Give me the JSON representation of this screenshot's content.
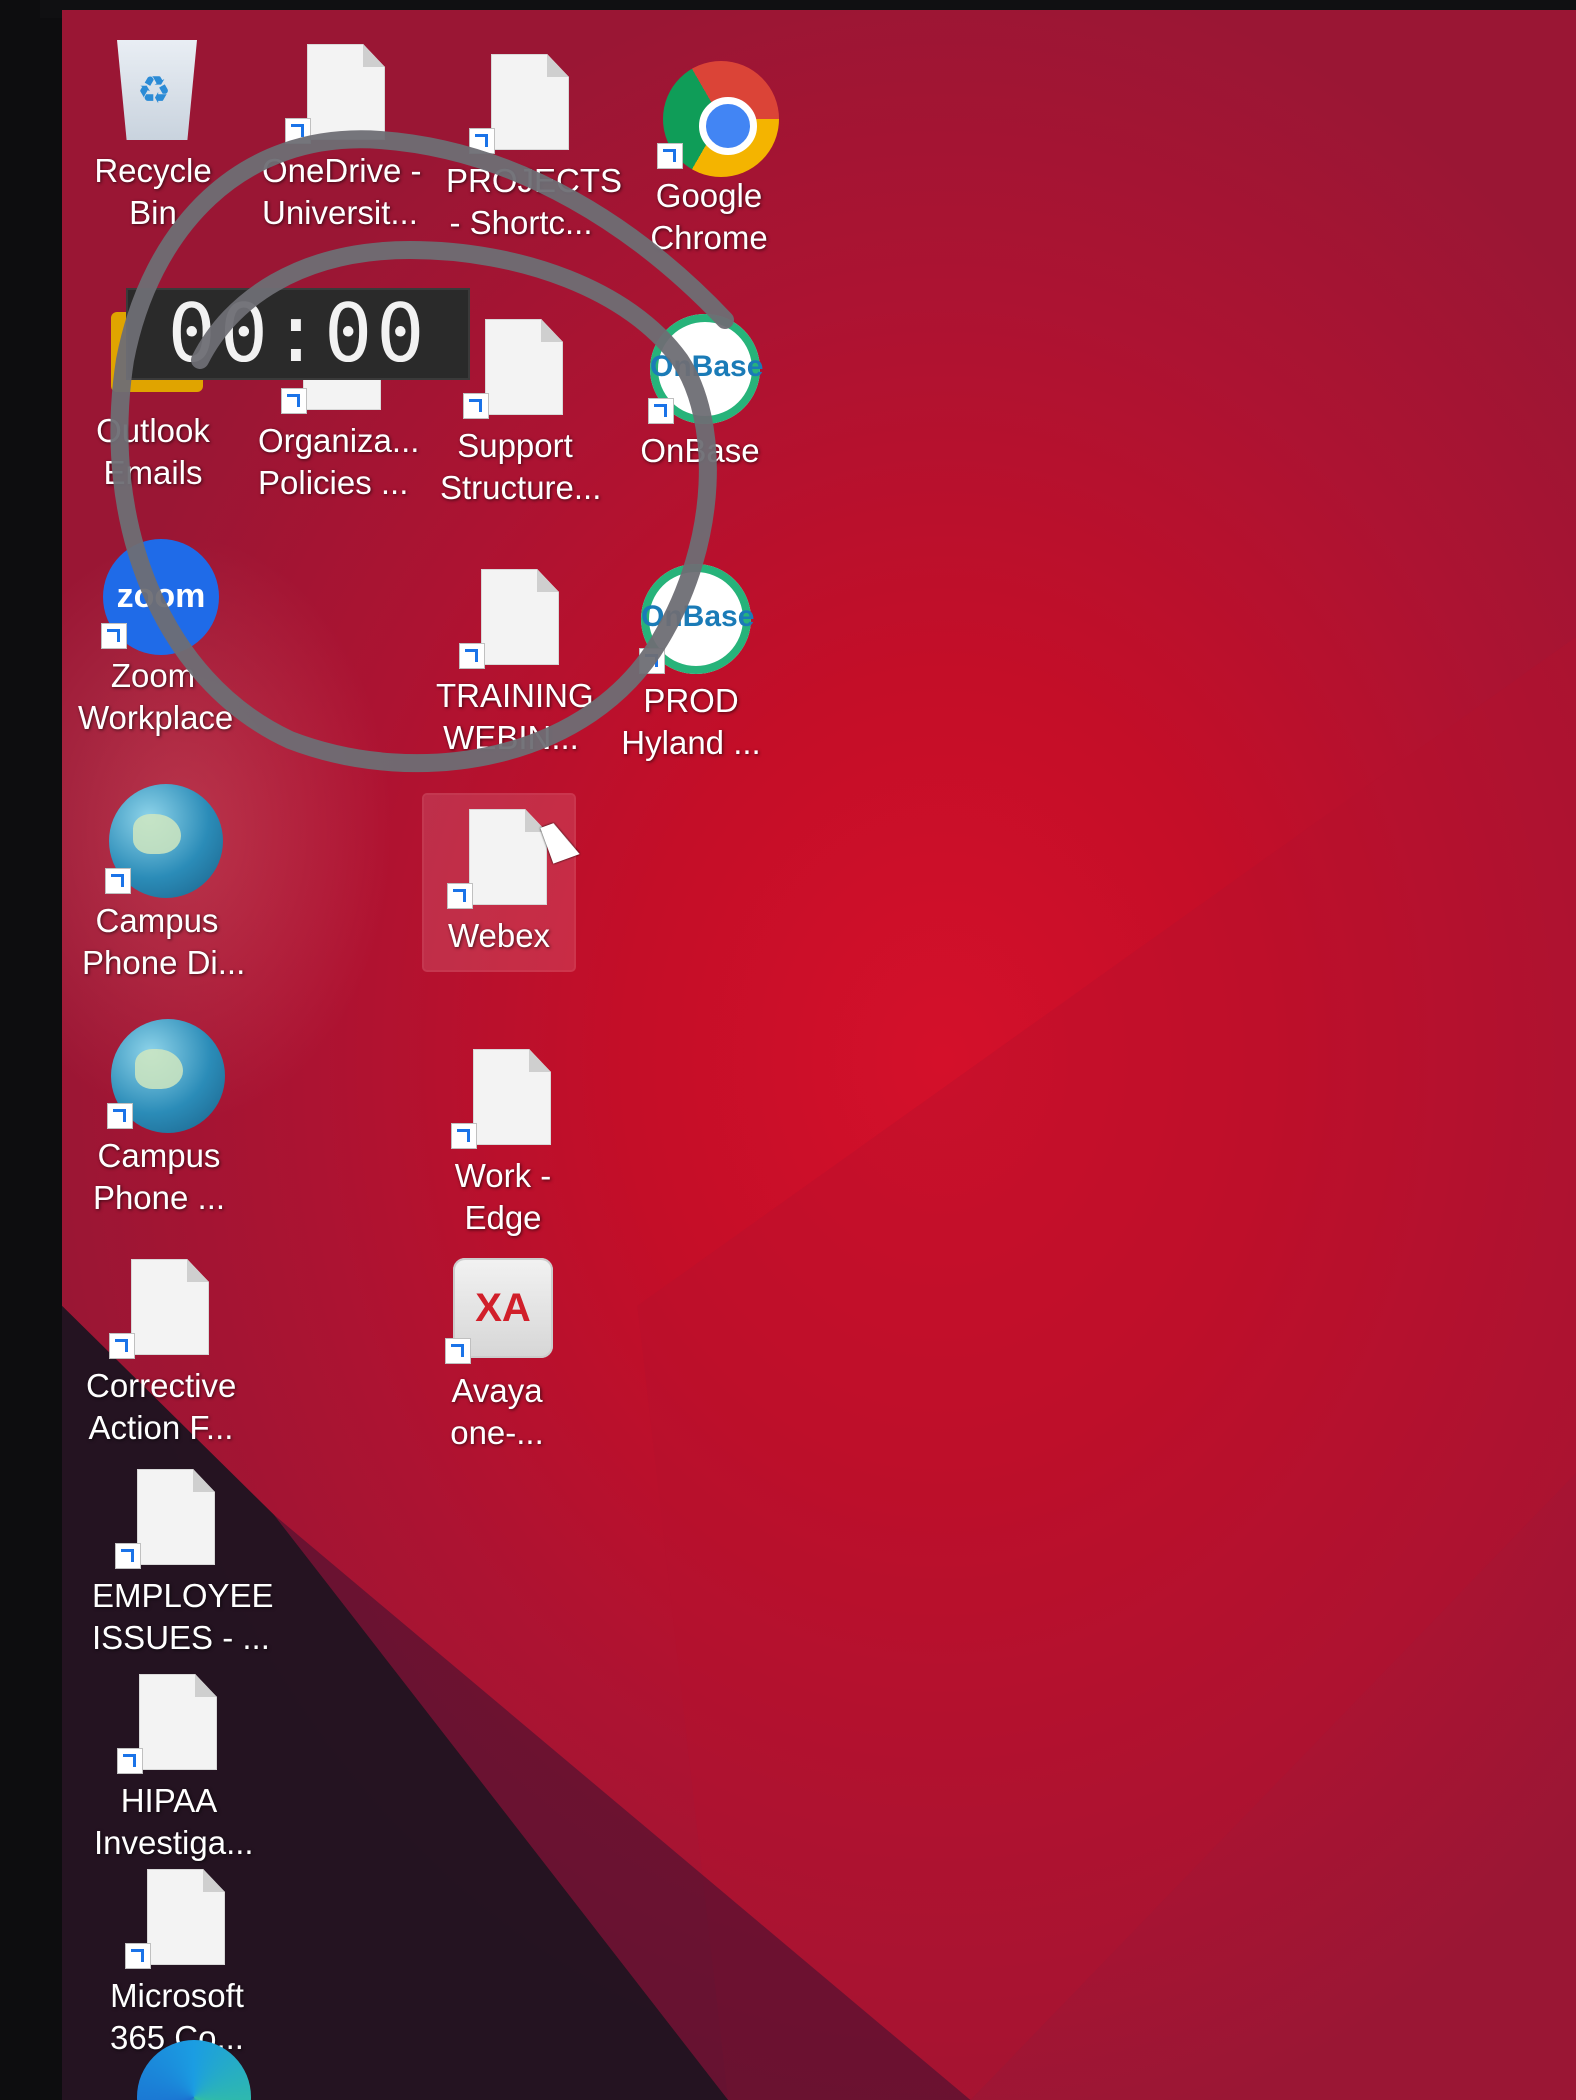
{
  "desktop": {
    "icons": [
      {
        "label_line1": "Recycle",
        "label_line2": "Bin",
        "icon": "recycle-bin-icon"
      },
      {
        "label_line1": "OneDrive -",
        "label_line2": "Universit...",
        "icon": "document-icon"
      },
      {
        "label_line1": "PROJECTS",
        "label_line2": "- Shortc...",
        "icon": "document-icon"
      },
      {
        "label_line1": "Google",
        "label_line2": "Chrome",
        "icon": "chrome-icon"
      },
      {
        "label_line1": "Outlook",
        "label_line2": "Emails",
        "icon": "outlook-icon"
      },
      {
        "label_line1": "Organiza...",
        "label_line2": "Policies ...",
        "icon": "document-icon"
      },
      {
        "label_line1": "Support",
        "label_line2": "Structure...",
        "icon": "document-icon"
      },
      {
        "label_line1": "OnBase",
        "label_line2": "",
        "icon": "onbase-icon",
        "logo_text": "OnBase"
      },
      {
        "label_line1": "Zoom",
        "label_line2": "Workplace",
        "icon": "zoom-icon",
        "logo_text": "zoom"
      },
      {
        "label_line1": "TRAINING",
        "label_line2": "WEBIN...",
        "icon": "document-icon"
      },
      {
        "label_line1": "PROD",
        "label_line2": "Hyland ...",
        "icon": "onbase-icon",
        "logo_text": "OnBase"
      },
      {
        "label_line1": "Campus",
        "label_line2": "Phone Di...",
        "icon": "globe-icon"
      },
      {
        "label_line1": "Webex",
        "label_line2": "",
        "icon": "document-icon",
        "selected": true
      },
      {
        "label_line1": "Campus",
        "label_line2": "Phone ...",
        "icon": "globe-icon"
      },
      {
        "label_line1": "Work -",
        "label_line2": "Edge",
        "icon": "document-icon"
      },
      {
        "label_line1": "Corrective",
        "label_line2": "Action F...",
        "icon": "document-icon"
      },
      {
        "label_line1": "Avaya",
        "label_line2": "one-...",
        "icon": "avaya-icon",
        "logo_text": "XA"
      },
      {
        "label_line1": "EMPLOYEE",
        "label_line2": "ISSUES - ...",
        "icon": "document-icon"
      },
      {
        "label_line1": "HIPAA",
        "label_line2": "Investiga...",
        "icon": "document-icon"
      },
      {
        "label_line1": "Microsoft",
        "label_line2": "365 Co...",
        "icon": "document-icon"
      },
      {
        "label_line1": "",
        "label_line2": "",
        "icon": "edge-icon"
      }
    ]
  },
  "overlay_timer": {
    "text": "00:00"
  },
  "colors": {
    "wallpaper": "#c40e28",
    "annotation_stroke": "#6e6e74"
  }
}
